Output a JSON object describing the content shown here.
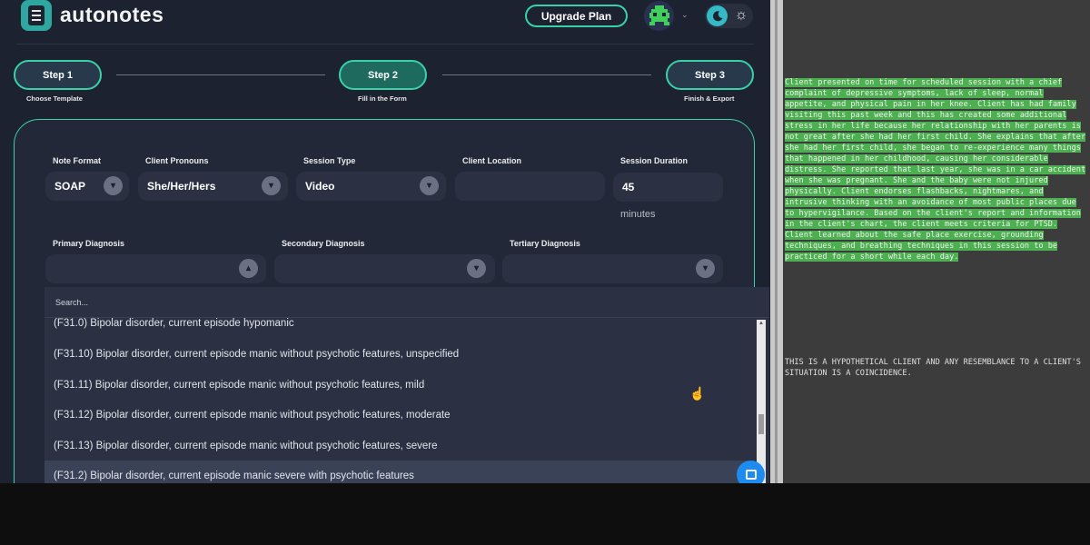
{
  "brand": {
    "name": "autonotes"
  },
  "header": {
    "upgrade_label": "Upgrade Plan",
    "chevron": "⌄",
    "sun": "☼"
  },
  "steps": [
    {
      "label": "Step 1",
      "caption": "Choose Template"
    },
    {
      "label": "Step 2",
      "caption": "Fill in the Form"
    },
    {
      "label": "Step 3",
      "caption": "Finish & Export"
    }
  ],
  "form": {
    "note_format": {
      "label": "Note Format",
      "value": "SOAP"
    },
    "client_pronouns": {
      "label": "Client Pronouns",
      "value": "She/Her/Hers"
    },
    "session_type": {
      "label": "Session Type",
      "value": "Video"
    },
    "client_location": {
      "label": "Client Location",
      "value": ""
    },
    "session_duration": {
      "label": "Session Duration",
      "value": "45",
      "unit": "minutes"
    },
    "primary_diagnosis": {
      "label": "Primary Diagnosis",
      "value": ""
    },
    "secondary_diagnosis": {
      "label": "Secondary Diagnosis",
      "value": ""
    },
    "tertiary_diagnosis": {
      "label": "Tertiary Diagnosis",
      "value": ""
    }
  },
  "dropdown": {
    "search_placeholder": "Search...",
    "options": [
      "(F31.0) Bipolar disorder, current episode hypomanic",
      "(F31.10) Bipolar disorder, current episode manic without psychotic features, unspecified",
      "(F31.11) Bipolar disorder, current episode manic without psychotic features, mild",
      "(F31.12) Bipolar disorder, current episode manic without psychotic features, moderate",
      "(F31.13) Bipolar disorder, current episode manic without psychotic features, severe",
      "(F31.2) Bipolar disorder, current episode manic severe with psychotic features"
    ],
    "highlighted_index": 5
  },
  "note_panel": {
    "body": "Client presented on time for scheduled session with a chief complaint of depressive symptoms, lack of sleep, normal appetite, and physical pain in her knee. Client has had family visiting this past week and this has created some additional stress in her life because her relationship with her parents is not great after she had her first child. She explains that after she had her first child, she began to re-experience many things that happened in her childhood, causing her considerable distress. She reported that last year, she was in a car accident when she was pregnant. She and the baby were not injured physically. Client endorses flashbacks, nightmares, and intrusive thinking with an avoidance of most public places due to hypervigilance. Based on the client's report and information in the client's chart, the client meets criteria for PTSD. Client learned about the safe place exercise, grounding techniques, and breathing techniques in this session to be practiced for a short while each day.",
    "disclaimer": "THIS IS A HYPOTHETICAL CLIENT AND ANY RESEMBLANCE TO A CLIENT'S SITUATION IS A COINCIDENCE."
  },
  "colors": {
    "accent": "#39d1a8",
    "highlight": "#4caf50",
    "chat": "#1d8bf0"
  }
}
